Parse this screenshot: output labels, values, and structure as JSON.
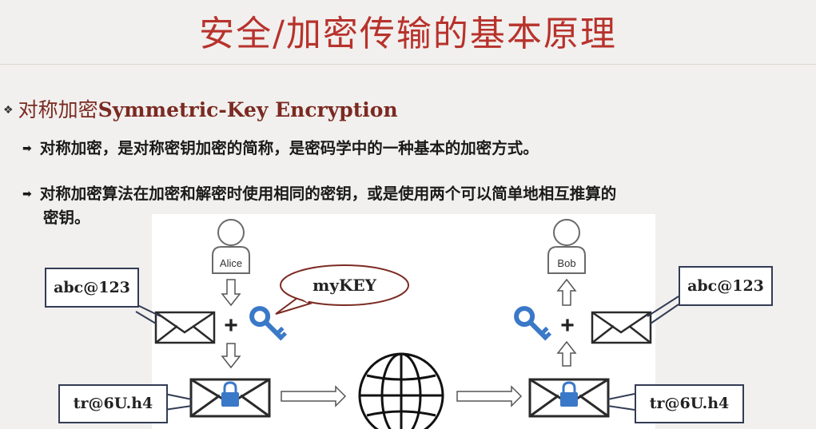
{
  "title": "安全/加密传输的基本原理",
  "section": {
    "bullet_icon": "diamond-bullet-icon",
    "label_cn": "对称加密",
    "label_en": "Symmetric-Key Encryption"
  },
  "points": [
    {
      "arrow_icon": "arrow-bullet-icon",
      "text": "对称加密，是对称密钥加密的简称，是密码学中的一种基本的加密方式。"
    },
    {
      "arrow_icon": "arrow-bullet-icon",
      "text_line1": "对称加密算法在加密和解密时使用相同的密钥，或是使用两个可以简单地相互推算的",
      "text_line2": "密钥。"
    }
  ],
  "diagram": {
    "sender": "Alice",
    "receiver": "Bob",
    "key_label": "myKEY",
    "plaintext_left": "abc@123",
    "plaintext_right": "abc@123",
    "ciphertext_left": "tr@6U.h4",
    "ciphertext_right": "tr@6U.h4",
    "plus": "+",
    "colors": {
      "key": "#3a78c8",
      "lock": "#3a78c8",
      "callout_border": "#333c55",
      "title": "#b8322c"
    }
  }
}
